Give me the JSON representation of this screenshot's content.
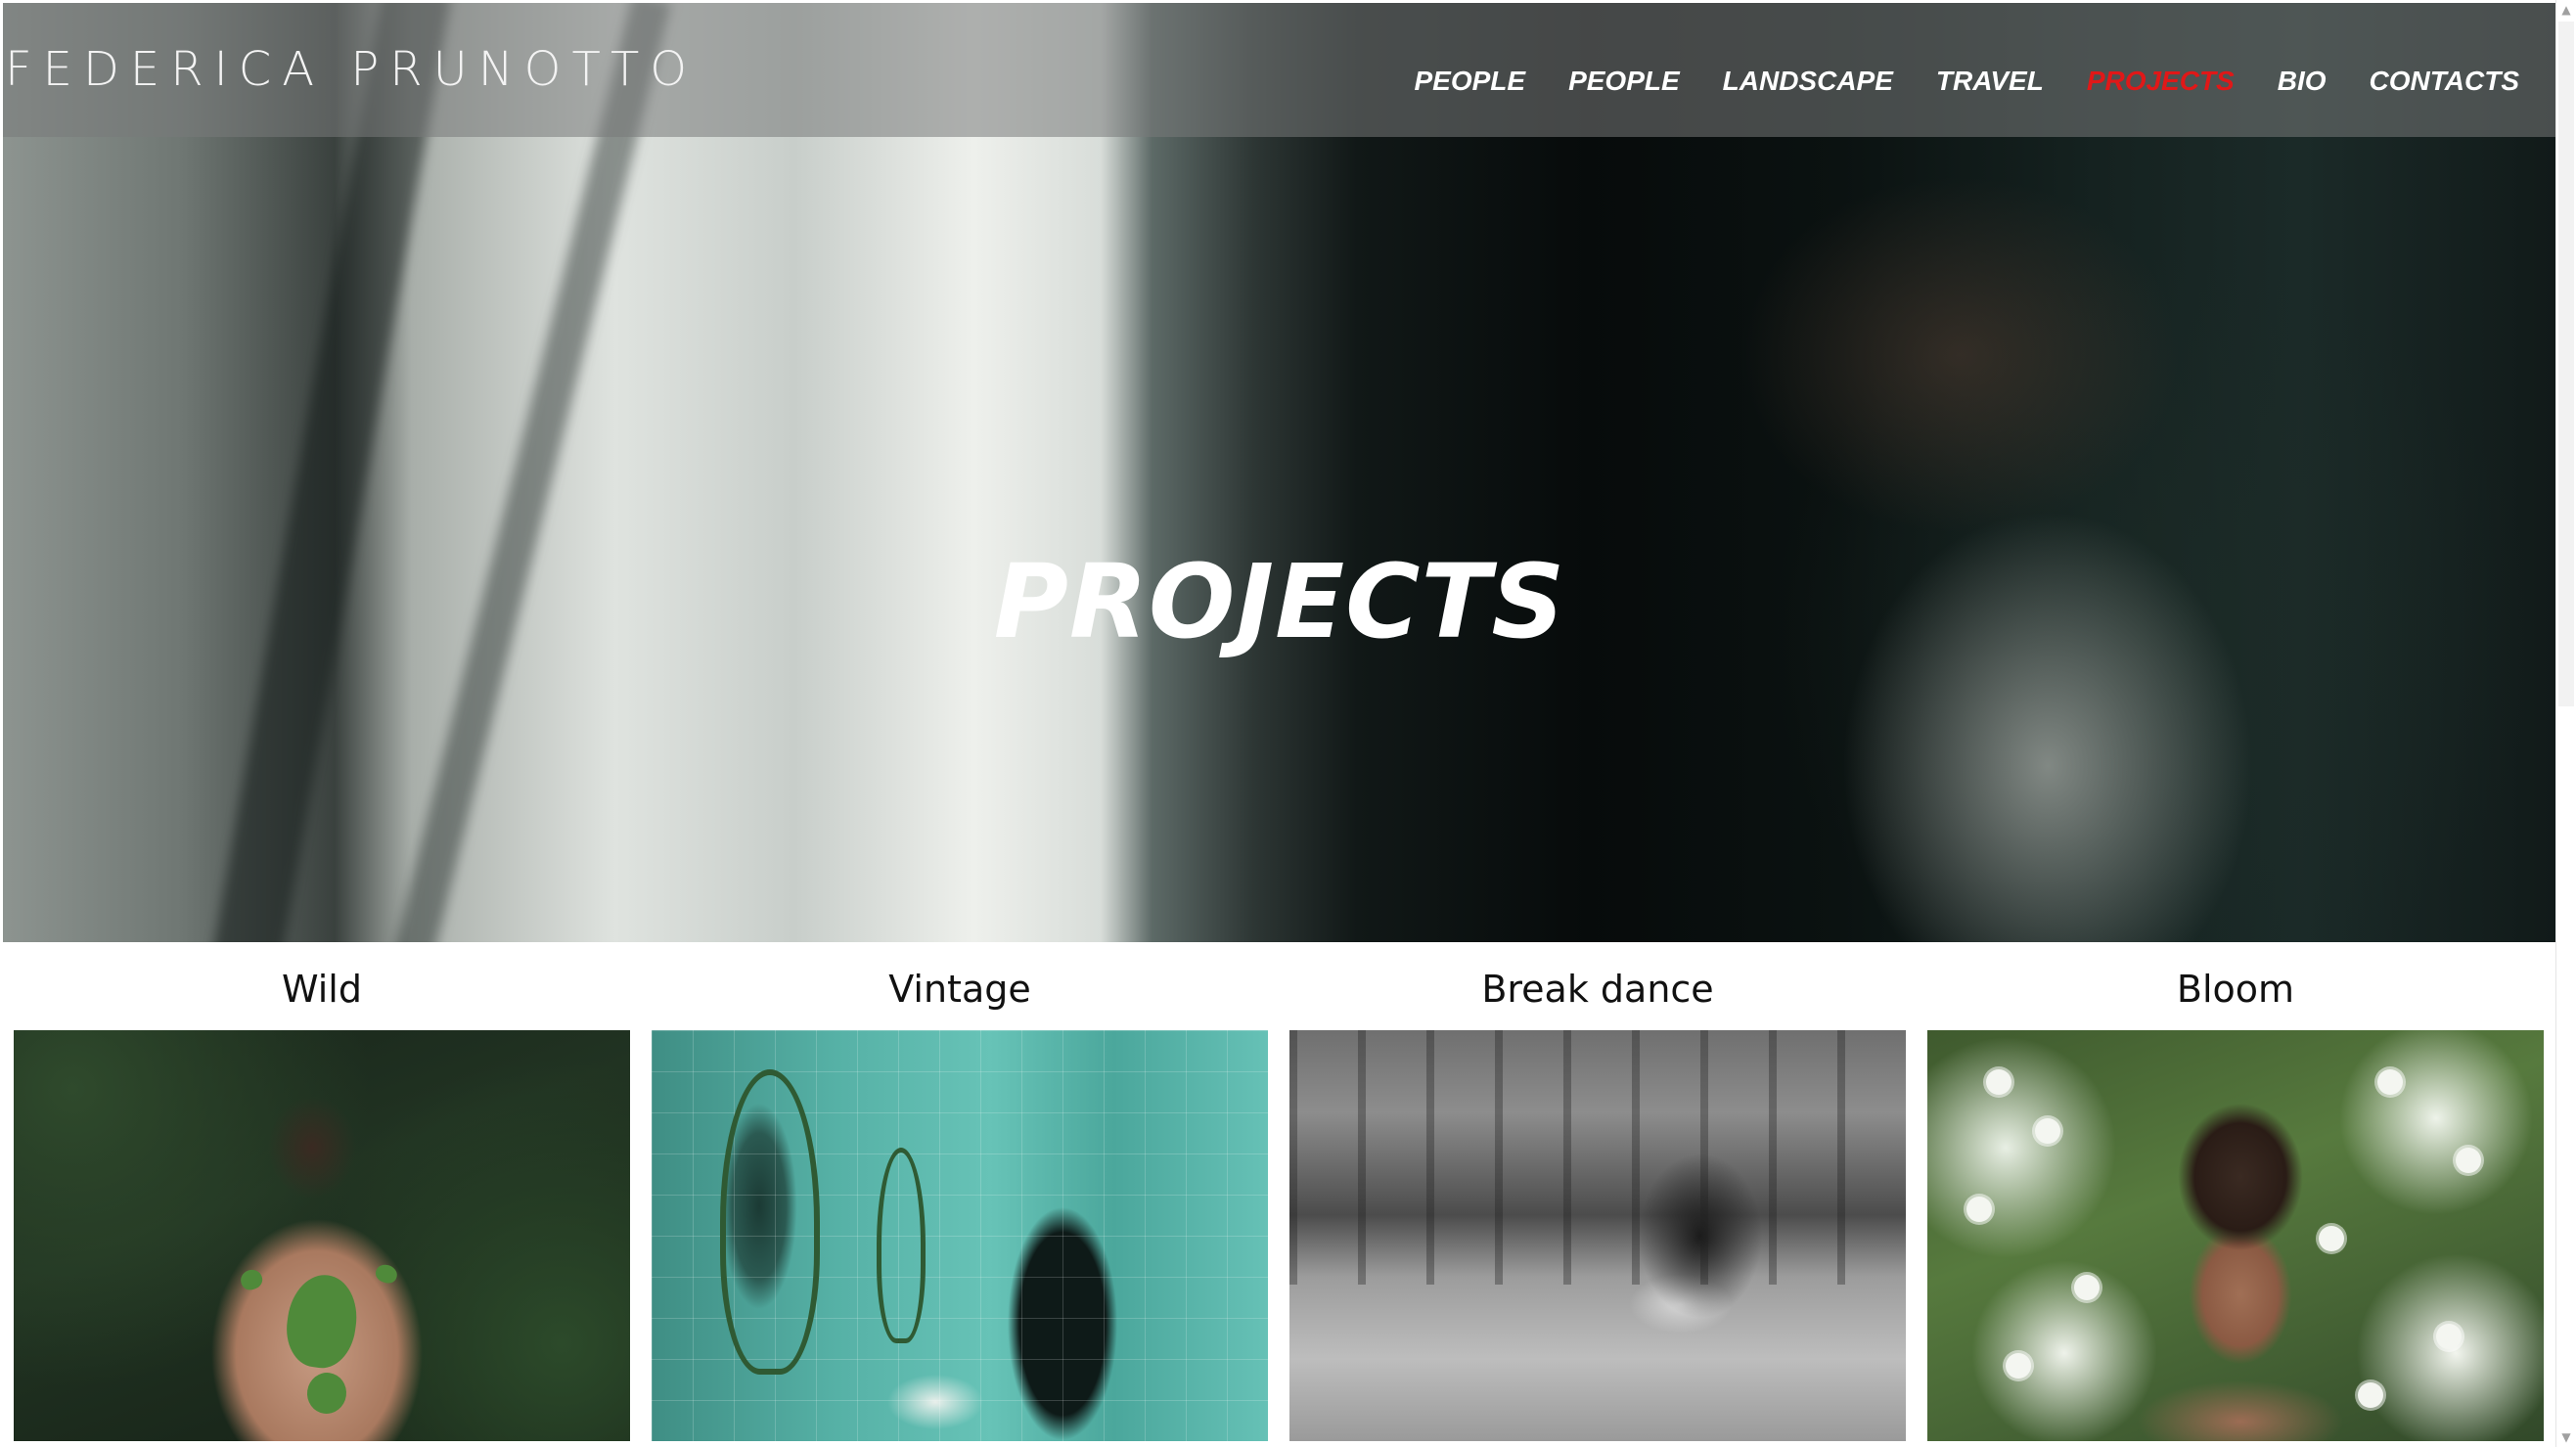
{
  "brand": {
    "name": "FEDERICA PRUNOTTO"
  },
  "nav": {
    "items": [
      {
        "label": "PEOPLE",
        "active": false
      },
      {
        "label": "PEOPLE",
        "active": false
      },
      {
        "label": "LANDSCAPE",
        "active": false
      },
      {
        "label": "TRAVEL",
        "active": false
      },
      {
        "label": "PROJECTS",
        "active": true
      },
      {
        "label": "BIO",
        "active": false
      },
      {
        "label": "CONTACTS",
        "active": false
      }
    ],
    "active_color": "#e01818"
  },
  "hero": {
    "title": "PROJECTS"
  },
  "projects": [
    {
      "title": "Wild"
    },
    {
      "title": "Vintage"
    },
    {
      "title": "Break dance"
    },
    {
      "title": "Bloom"
    }
  ],
  "scrollbar": {
    "up_icon": "scroll-up-arrow-icon",
    "down_icon": "scroll-down-arrow-icon"
  }
}
